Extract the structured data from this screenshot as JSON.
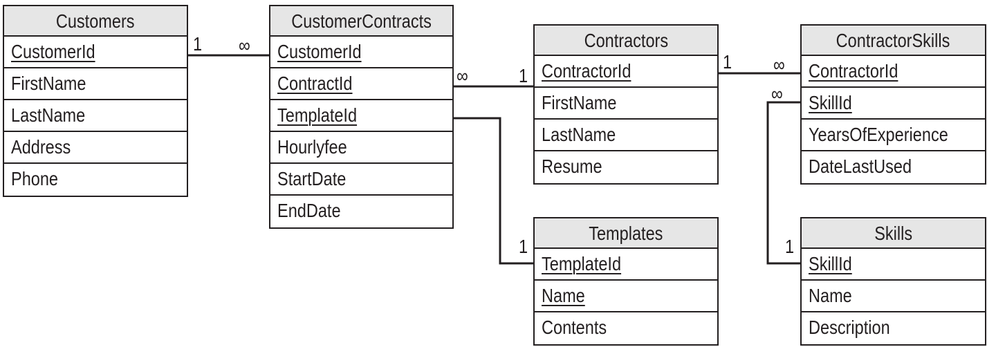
{
  "tables": [
    {
      "id": "customers",
      "name": "Customers",
      "fields": [
        {
          "name": "CustomerId",
          "key": true
        },
        {
          "name": "FirstName",
          "key": false
        },
        {
          "name": "LastName",
          "key": false
        },
        {
          "name": "Address",
          "key": false
        },
        {
          "name": "Phone",
          "key": false
        }
      ]
    },
    {
      "id": "customer-contracts",
      "name": "CustomerContracts",
      "fields": [
        {
          "name": "CustomerId",
          "key": true
        },
        {
          "name": "ContractId",
          "key": true
        },
        {
          "name": "TemplateId",
          "key": true
        },
        {
          "name": "Hourlyfee",
          "key": false
        },
        {
          "name": "StartDate",
          "key": false
        },
        {
          "name": "EndDate",
          "key": false
        }
      ]
    },
    {
      "id": "contractors",
      "name": "Contractors",
      "fields": [
        {
          "name": "ContractorId",
          "key": true
        },
        {
          "name": "FirstName",
          "key": false
        },
        {
          "name": "LastName",
          "key": false
        },
        {
          "name": "Resume",
          "key": false
        }
      ]
    },
    {
      "id": "contractor-skills",
      "name": "ContractorSkills",
      "fields": [
        {
          "name": "ContractorId",
          "key": true
        },
        {
          "name": "SkillId",
          "key": true
        },
        {
          "name": "YearsOfExperience",
          "key": false
        },
        {
          "name": "DateLastUsed",
          "key": false
        }
      ]
    },
    {
      "id": "templates",
      "name": "Templates",
      "fields": [
        {
          "name": "TemplateId",
          "key": true
        },
        {
          "name": "Name",
          "key": true
        },
        {
          "name": "Contents",
          "key": false
        }
      ]
    },
    {
      "id": "skills",
      "name": "Skills",
      "fields": [
        {
          "name": "SkillId",
          "key": true
        },
        {
          "name": "Name",
          "key": false
        },
        {
          "name": "Description",
          "key": false
        }
      ]
    }
  ],
  "relationships": [
    {
      "from": "customers.CustomerId",
      "to": "customer-contracts.CustomerId",
      "from_card": "1",
      "to_card": "∞"
    },
    {
      "from": "customer-contracts.ContractId",
      "to": "contractors.ContractorId",
      "from_card": "∞",
      "to_card": "1"
    },
    {
      "from": "customer-contracts.TemplateId",
      "to": "templates.TemplateId",
      "from_card": "",
      "to_card": "1"
    },
    {
      "from": "contractors.ContractorId",
      "to": "contractor-skills.ContractorId",
      "from_card": "1",
      "to_card": "∞"
    },
    {
      "from": "contractor-skills.SkillId",
      "to": "skills.SkillId",
      "from_card": "∞",
      "to_card": "1"
    }
  ]
}
